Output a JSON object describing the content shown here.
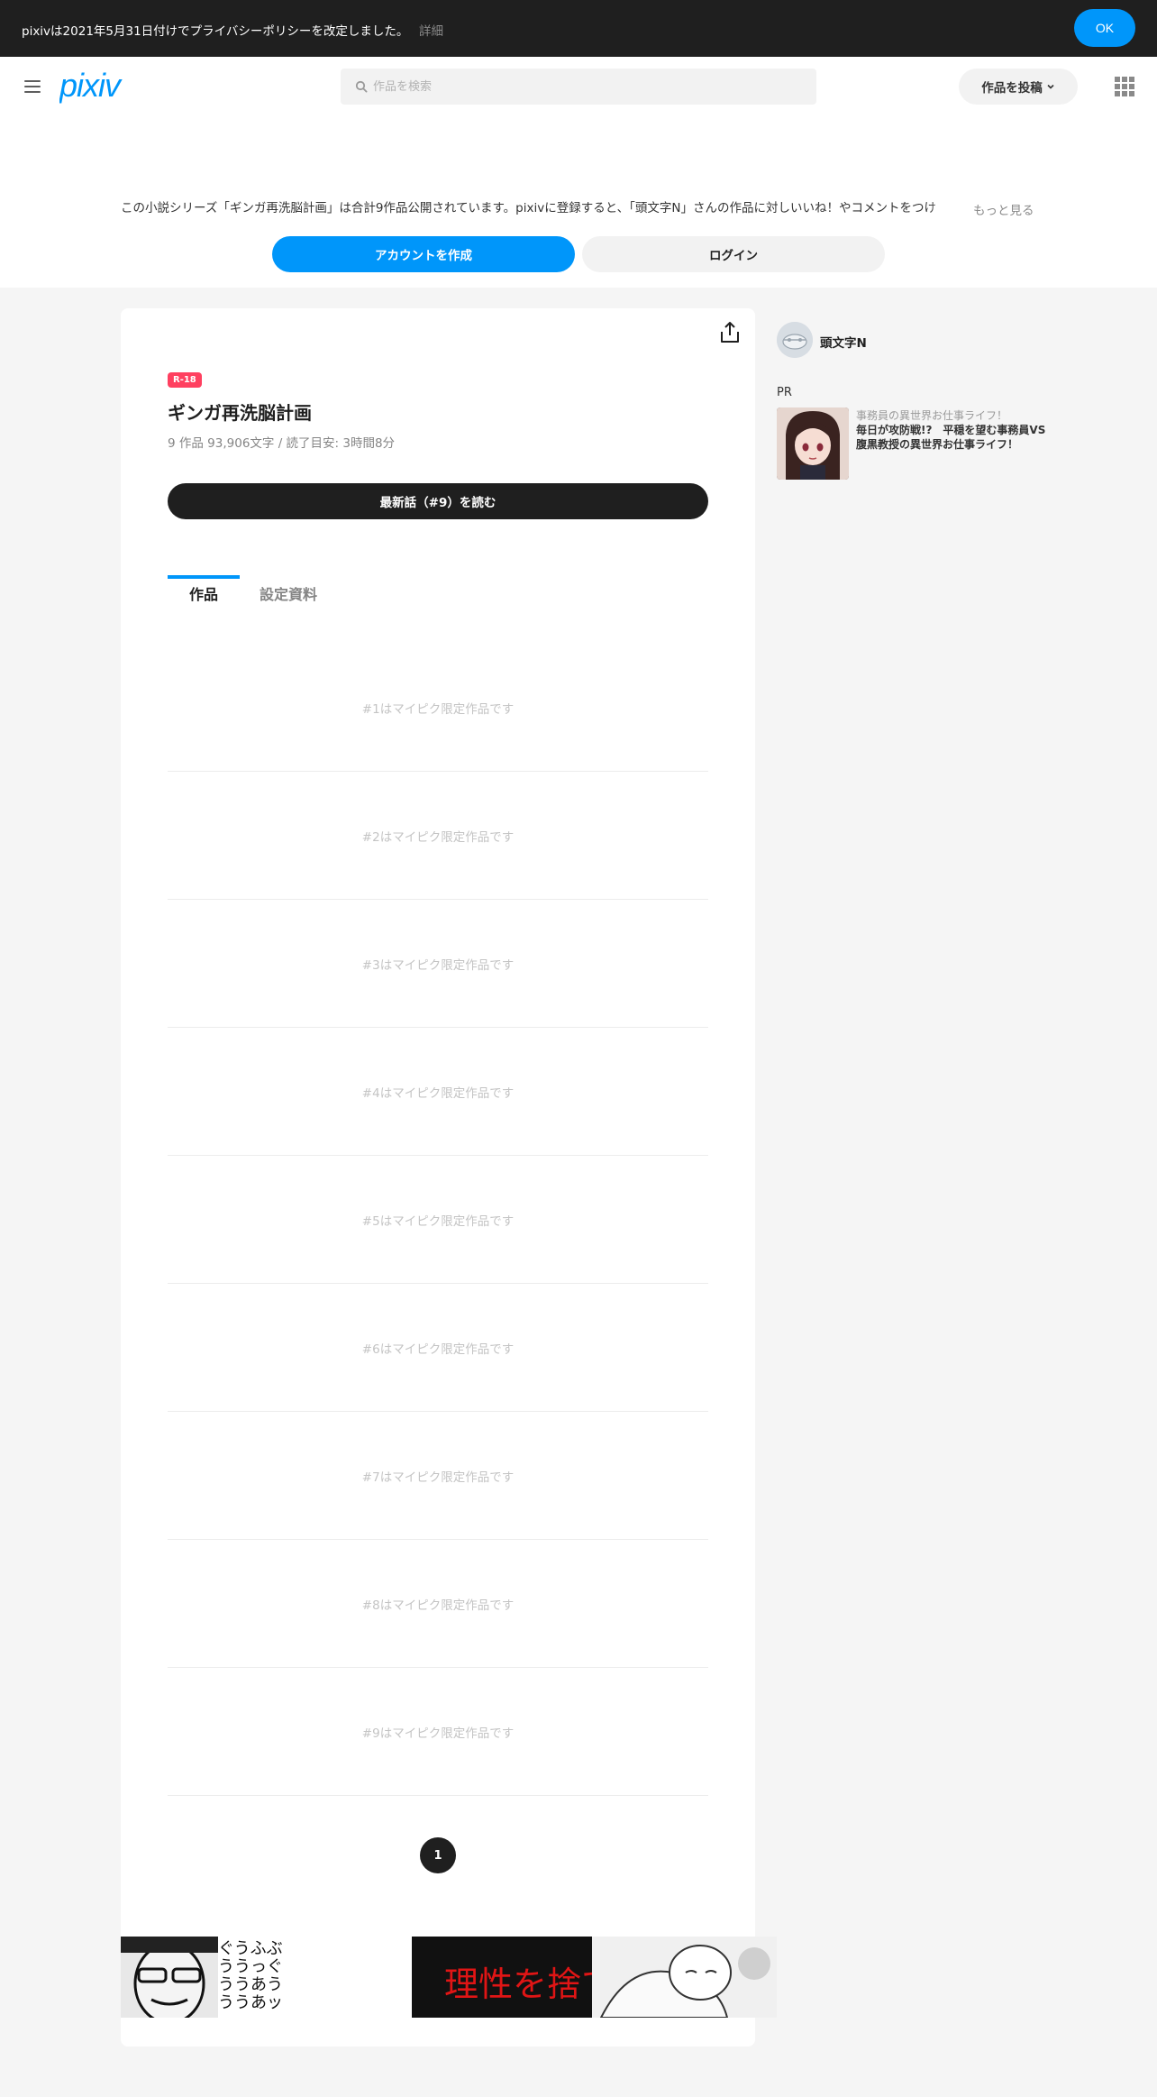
{
  "notice": {
    "text": "pixivは2021年5月31日付けでプライバシーポリシーを改定しました。",
    "link": "詳細",
    "ok_label": "OK"
  },
  "header": {
    "search_placeholder": "作品を検索",
    "post_label": "作品を投稿"
  },
  "promo": {
    "text": "この小説シリーズ「ギンガ再洗脳計画」は合計9作品公開されています。pixivに登録すると、「頭文字N」さんの作品に対しいいね！やコメントをつけ",
    "more_label": "もっと見る",
    "create_account_label": "アカウントを作成",
    "login_label": "ログイン"
  },
  "series": {
    "badge": "R-18",
    "title": "ギンガ再洗脳計画",
    "meta": "9 作品  93,906文字 / 読了目安: 3時間8分",
    "read_latest_label": "最新話（#9）を読む",
    "tabs": [
      "作品",
      "設定資料"
    ],
    "works": [
      "#1はマイピク限定作品です",
      "#2はマイピク限定作品です",
      "#3はマイピク限定作品です",
      "#4はマイピク限定作品です",
      "#5はマイピク限定作品です",
      "#6はマイピク限定作品です",
      "#7はマイピク限定作品です",
      "#8はマイピク限定作品です",
      "#9はマイピク限定作品です"
    ],
    "page": "1"
  },
  "ad": {
    "kana_lines": [
      "ぐうふぶ",
      "ううっぐ",
      "ううあう",
      "ううあッ"
    ],
    "main_text": "理性を捨てて―"
  },
  "sidebar": {
    "author_name": "頭文字N",
    "pr_label": "PR",
    "pr_subtitle": "事務員の異世界お仕事ライフ！",
    "pr_title": "毎日が攻防戦!?　平穏を望む事務員VS腹黒教授の異世界お仕事ライフ！"
  },
  "colors": {
    "accent": "#0096fa",
    "dark": "#1f1f1f",
    "r18_badge": "#ff4060",
    "ad_red": "#e01515"
  },
  "icons": [
    "hamburger-icon",
    "pixiv-logo",
    "search-icon",
    "chevron-down-icon",
    "grid-icon",
    "share-icon"
  ]
}
